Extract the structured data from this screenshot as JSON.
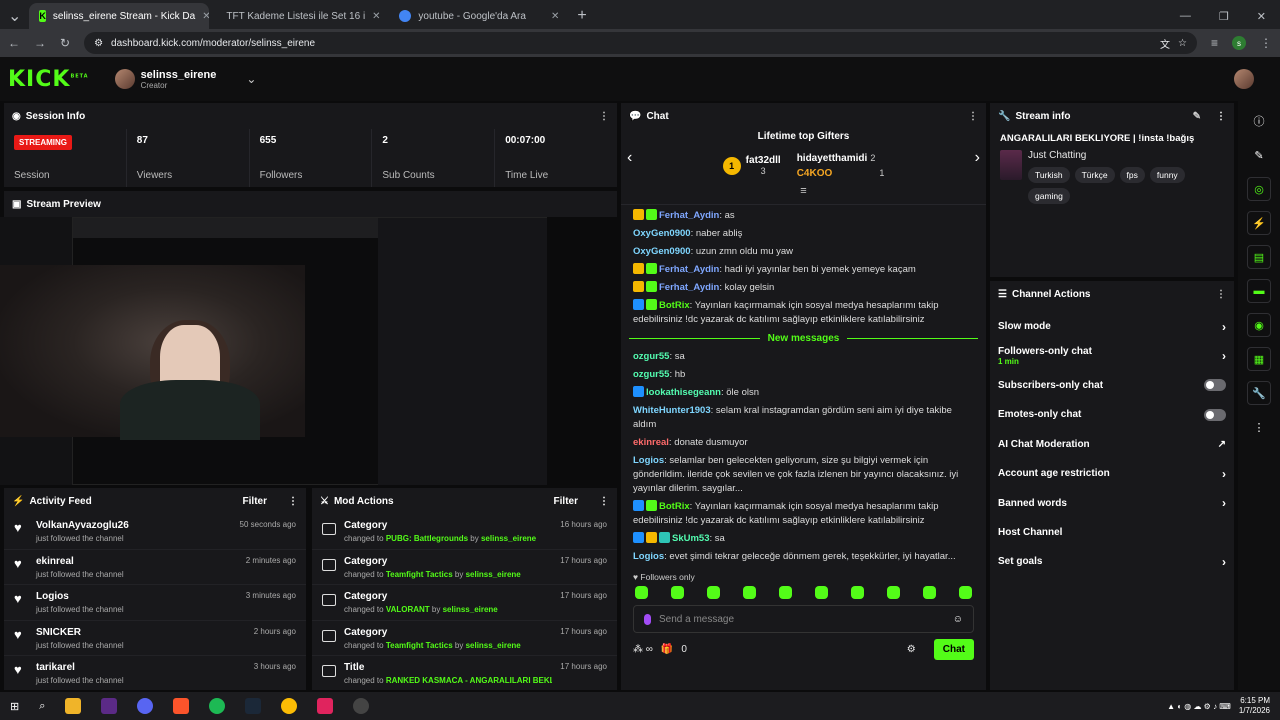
{
  "browser": {
    "tabs": [
      {
        "title": "selinss_eirene Stream - Kick Da",
        "active": true
      },
      {
        "title": "TFT Kademe Listesi ile Set 16 i",
        "active": false
      },
      {
        "title": "youtube - Google'da Ara",
        "active": false
      }
    ],
    "url": "dashboard.kick.com/moderator/selinss_eirene",
    "profile_initial": "s"
  },
  "header": {
    "logo": "KICK",
    "logo_beta": "BETA",
    "username": "selinss_eirene",
    "role": "Creator"
  },
  "session": {
    "title": "Session Info",
    "status_badge": "STREAMING",
    "status_label": "Session",
    "stats": [
      {
        "value": "87",
        "label": "Viewers"
      },
      {
        "value": "655",
        "label": "Followers"
      },
      {
        "value": "2",
        "label": "Sub Counts"
      },
      {
        "value": "00:07:00",
        "label": "Time Live"
      }
    ]
  },
  "preview": {
    "title": "Stream Preview"
  },
  "activity": {
    "title": "Activity Feed",
    "filter": "Filter",
    "items": [
      {
        "name": "VolkanAyvazoglu26",
        "sub": "just followed the channel",
        "time": "50 seconds ago"
      },
      {
        "name": "ekinreal",
        "sub": "just followed the channel",
        "time": "2 minutes ago"
      },
      {
        "name": "Logios",
        "sub": "just followed the channel",
        "time": "3 minutes ago"
      },
      {
        "name": "SNICKER",
        "sub": "just followed the channel",
        "time": "2 hours ago"
      },
      {
        "name": "tarikarel",
        "sub": "just followed the channel",
        "time": "3 hours ago"
      }
    ]
  },
  "mod": {
    "title": "Mod Actions",
    "filter": "Filter",
    "items": [
      {
        "title": "Category",
        "pre": "changed to",
        "target": "PUBG: Battlegrounds",
        "by": "by",
        "user": "selinss_eirene",
        "time": "16 hours ago"
      },
      {
        "title": "Category",
        "pre": "changed to",
        "target": "Teamfight Tactics",
        "by": "by",
        "user": "selinss_eirene",
        "time": "17 hours ago"
      },
      {
        "title": "Category",
        "pre": "changed to",
        "target": "VALORANT",
        "by": "by",
        "user": "selinss_eirene",
        "time": "17 hours ago"
      },
      {
        "title": "Category",
        "pre": "changed to",
        "target": "Teamfight Tactics",
        "by": "by",
        "user": "selinss_eirene",
        "time": "17 hours ago"
      },
      {
        "title": "Title",
        "pre": "changed to",
        "target": "RANKED KASMACA - ANGARALILARI BEKLIYORE | !insta",
        "by": "",
        "user": "",
        "time": "17 hours ago"
      }
    ]
  },
  "chat": {
    "title": "Chat",
    "gifters_title": "Lifetime top Gifters",
    "gifters": [
      {
        "rank": "1",
        "name": "fat32dll",
        "count": "3"
      },
      {
        "name": "hidayetthamidi",
        "count": "2"
      },
      {
        "name": "C4KOO",
        "count": "1"
      }
    ],
    "messages_before": [
      {
        "user": "Ferhat_Aydin",
        "color": "#7fa7ff",
        "badges": [
          "#f5b800",
          "#53fc18"
        ],
        "text": "as"
      },
      {
        "user": "OxyGen0900",
        "color": "#7fd6ff",
        "badges": [],
        "text": "naber abliş"
      },
      {
        "user": "OxyGen0900",
        "color": "#7fd6ff",
        "badges": [],
        "text": "uzun zmn oldu mu yaw"
      },
      {
        "user": "Ferhat_Aydin",
        "color": "#7fa7ff",
        "badges": [
          "#f5b800",
          "#53fc18"
        ],
        "text": "hadi iyi yayınlar ben bi yemek yemeye kaçam"
      },
      {
        "user": "Ferhat_Aydin",
        "color": "#7fa7ff",
        "badges": [
          "#f5b800",
          "#53fc18"
        ],
        "text": "kolay gelsin"
      },
      {
        "user": "BotRix",
        "color": "#53fc18",
        "badges": [
          "#1e90ff",
          "#53fc18"
        ],
        "text": "Yayınları kaçırmamak için sosyal medya hesaplarımı takip edebilirsiniz !dc yazarak dc katılımı sağlayıp etkinliklere katılabilirsiniz"
      }
    ],
    "new_messages": "New messages",
    "messages_after": [
      {
        "user": "ozgur55",
        "color": "#53fcb0",
        "badges": [],
        "text": "sa"
      },
      {
        "user": "ozgur55",
        "color": "#53fcb0",
        "badges": [],
        "text": "hb"
      },
      {
        "user": "lookathisegeann",
        "color": "#53fcb0",
        "badges": [
          "#1e90ff"
        ],
        "text": "öle olsn"
      },
      {
        "user": "WhiteHunter1903",
        "color": "#7fd6ff",
        "badges": [],
        "text": "selam kral instagramdan gördüm seni aim iyi diye takibe aldım"
      },
      {
        "user": "ekinreal",
        "color": "#ff6b6b",
        "badges": [],
        "text": "donate dusmuyor"
      },
      {
        "user": "Logios",
        "color": "#7fd6ff",
        "badges": [],
        "text": "selamlar ben gelecekten geliyorum, size şu bilgiyi vermek için gönderildim. ileride çok sevilen ve çok fazla izlenen bir yayıncı olacaksınız. iyi yayınlar dilerim. saygılar..."
      },
      {
        "user": "BotRix",
        "color": "#53fc18",
        "badges": [
          "#1e90ff",
          "#53fc18"
        ],
        "text": "Yayınları kaçırmamak için sosyal medya hesaplarımı takip edebilirsiniz !dc yazarak dc katılımı sağlayıp etkinliklere katılabilirsiniz"
      },
      {
        "user": "SkUm53",
        "color": "#53fcb0",
        "badges": [
          "#1e90ff",
          "#f5b800",
          "#2ec4b6"
        ],
        "text": "sa"
      },
      {
        "user": "Logios",
        "color": "#7fd6ff",
        "badges": [],
        "text": "evet şimdi tekrar geleceğe dönmem gerek, teşekkürler, iyi hayatlar..."
      }
    ],
    "followers_only": "Followers only",
    "placeholder": "Send a message",
    "count": "0",
    "send": "Chat"
  },
  "stream_info": {
    "title": "Stream info",
    "stream_title": "ANGARALILARI BEKLIYORE | !insta !bağış",
    "category": "Just Chatting",
    "tags": [
      "Turkish",
      "Türkçe",
      "fps",
      "funny",
      "gaming"
    ]
  },
  "channel_actions": {
    "title": "Channel Actions",
    "items": [
      {
        "label": "Slow mode",
        "kind": "arrow"
      },
      {
        "label": "Followers-only chat",
        "sub": "1 min",
        "kind": "arrow"
      },
      {
        "label": "Subscribers-only chat",
        "kind": "toggle"
      },
      {
        "label": "Emotes-only chat",
        "kind": "toggle"
      },
      {
        "label": "AI Chat Moderation",
        "kind": "external"
      },
      {
        "label": "Account age restriction",
        "kind": "arrow"
      },
      {
        "label": "Banned words",
        "kind": "arrow"
      },
      {
        "label": "Host Channel",
        "kind": "none"
      },
      {
        "label": "Set goals",
        "kind": "arrow"
      }
    ]
  },
  "taskbar": {
    "time": "6:15 PM",
    "date": "1/7/2026"
  }
}
